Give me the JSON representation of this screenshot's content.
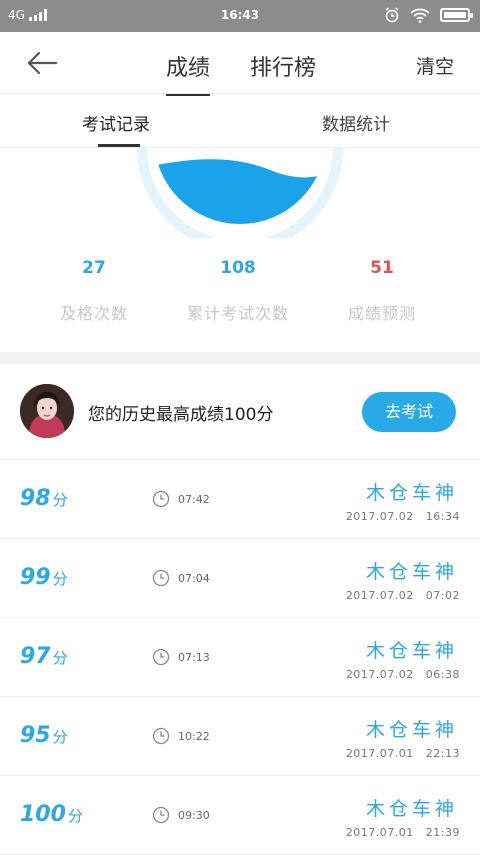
{
  "status": {
    "network": "4G",
    "time": "16:43"
  },
  "nav": {
    "tabs": [
      "成绩",
      "排行榜"
    ],
    "active_tab": "成绩",
    "clear_label": "清空"
  },
  "subtabs": {
    "items": [
      "考试记录",
      "数据统计"
    ],
    "active": "考试记录"
  },
  "stats": [
    {
      "value": "27",
      "label": "及格次数",
      "color": "#2da8e5"
    },
    {
      "value": "108",
      "label": "累计考试次数",
      "color": "#2da8e5"
    },
    {
      "value": "51",
      "label": "成绩预测",
      "color": "#e65050"
    }
  ],
  "profile": {
    "best_text": "您的历史最高成绩100分",
    "exam_button": "去考试"
  },
  "records": [
    {
      "score": "98",
      "unit": "分",
      "duration": "07:42",
      "name": "木仓车神",
      "date": "2017.07.02 16:34"
    },
    {
      "score": "99",
      "unit": "分",
      "duration": "07:04",
      "name": "木仓车神",
      "date": "2017.07.02 07:02"
    },
    {
      "score": "97",
      "unit": "分",
      "duration": "07:13",
      "name": "木仓车神",
      "date": "2017.07.02 06:38"
    },
    {
      "score": "95",
      "unit": "分",
      "duration": "10:22",
      "name": "木仓车神",
      "date": "2017.07.01 22:13"
    },
    {
      "score": "100",
      "unit": "分",
      "duration": "09:30",
      "name": "木仓车神",
      "date": "2017.07.01 21:39"
    }
  ],
  "colors": {
    "accent": "#29a9e6",
    "gauge_ring": "#e3f4fc",
    "prediction": "#e65050"
  }
}
